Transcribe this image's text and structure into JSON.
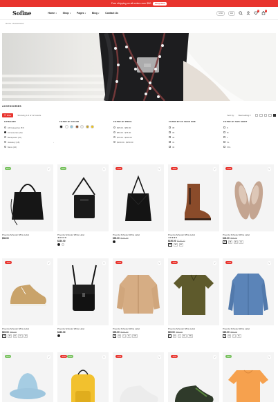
{
  "topbar": {
    "text": "Free shipping on all orders over $50",
    "cta": "Shop Now"
  },
  "header": {
    "logo": "Sofine",
    "nav": [
      "Home",
      "Shop",
      "Pages",
      "Blog",
      "Contact Us"
    ],
    "currency": "USD",
    "language": "EN",
    "wishlist_count": "0",
    "cart_count": "0"
  },
  "breadcrumb": "Home / Accessories",
  "page_title": "ACCESSORIES",
  "toolbar": {
    "filter_label": "Filter",
    "showing": "Showing 1-9 of 12 results",
    "sort_label": "Sort by:",
    "sort_value": "Best selling"
  },
  "filters": {
    "category": {
      "title": "CATEGORY",
      "items": [
        {
          "label": "All Categories (57)",
          "selected": false
        },
        {
          "label": "Accessories (22)",
          "selected": true
        },
        {
          "label": "Backpacks (10)",
          "selected": false
        },
        {
          "label": "Jewelery (18)",
          "selected": false
        },
        {
          "label": "Mens (10)",
          "selected": false
        }
      ]
    },
    "color": {
      "title": "FILTER BY COLOR",
      "swatches": [
        "#111111",
        "#ffffff",
        "#8ec9df",
        "#8b4a22",
        "#f2f2f2",
        "#c9a227",
        "#f1c40f"
      ]
    },
    "price": {
      "title": "FILTER BY PRICE",
      "items": [
        "$25.00 - $50.00",
        "$50.00 - $75.00",
        "$75.00 - $100.00",
        "$100.00 - $150.00"
      ]
    },
    "shoe_size": {
      "title": "FILTER BY EU SHOE SIZE",
      "items": [
        "38",
        "39",
        "40",
        "41",
        "42"
      ]
    },
    "shirt_size": {
      "title": "FILTER BY SIZE SHIRT",
      "items": [
        "S",
        "M",
        "L",
        "XL",
        "XXL"
      ]
    }
  },
  "products": [
    {
      "name": "Proenza Schouler White Label",
      "tag": "New",
      "tag2": "",
      "stars": "",
      "price": "$56.00",
      "old_price": "",
      "options": [],
      "colors": []
    },
    {
      "name": "Proenza Schouler White Label",
      "tag": "New",
      "tag2": "",
      "stars": "★★★★★",
      "price": "$230.00",
      "old_price": "",
      "options": [],
      "colors": [
        "#111111",
        "#ffffff"
      ]
    },
    {
      "name": "Proenza Schouler White Label",
      "tag": "-12%",
      "tag2": "",
      "stars": "",
      "price": "$95.00",
      "old_price": "$110.00",
      "options": [],
      "colors": [
        "#111111"
      ]
    },
    {
      "name": "Proenza Schouler White Label",
      "tag": "-20%",
      "tag2": "",
      "stars": "★★★★★",
      "price": "$150.00",
      "old_price": "$190.00",
      "options": [
        "38",
        "39",
        "40"
      ],
      "colors": []
    },
    {
      "name": "Proenza Schouler White Label",
      "tag": "-12%",
      "tag2": "",
      "stars": "",
      "price": "$45.00",
      "old_price": "$55.00",
      "options": [
        "38",
        "39",
        "40",
        "41"
      ],
      "colors": []
    },
    {
      "name": "Proenza Schouler White Label",
      "tag": "-15%",
      "tag2": "",
      "stars": "",
      "price": "$69.00",
      "old_price": "$80.00",
      "options": [
        "38",
        "39",
        "40",
        "41",
        "42"
      ],
      "colors": []
    },
    {
      "name": "Proenza Schouler White Label",
      "tag": "",
      "tag2": "",
      "stars": "",
      "price": "$230.00",
      "old_price": "",
      "options": [],
      "colors": [
        "#111111"
      ]
    },
    {
      "name": "Proenza Schouler White Label",
      "tag": "-12%",
      "tag2": "",
      "stars": "",
      "price": "$95.00",
      "old_price": "$110.00",
      "options": [
        "S",
        "M",
        "L",
        "XL",
        "XXL"
      ],
      "colors": []
    },
    {
      "name": "Proenza Schouler White Label",
      "tag": "-12%",
      "tag2": "",
      "stars": "",
      "price": "$69.00",
      "old_price": "$80.00",
      "options": [
        "S",
        "M",
        "L",
        "XL",
        "XXL"
      ],
      "colors": []
    },
    {
      "name": "Proenza Schouler White Label",
      "tag": "-12%",
      "tag2": "",
      "stars": "",
      "price": "$69.00",
      "old_price": "$80.00",
      "options": [
        "S",
        "M",
        "L",
        "XL"
      ],
      "colors": []
    },
    {
      "name": "",
      "tag": "New",
      "tag2": "",
      "stars": "",
      "price": "",
      "old_price": "",
      "options": [],
      "colors": []
    },
    {
      "name": "",
      "tag": "-13%",
      "tag2": "New",
      "stars": "",
      "price": "",
      "old_price": "",
      "options": [],
      "colors": []
    },
    {
      "name": "",
      "tag": "-12%",
      "tag2": "",
      "stars": "",
      "price": "",
      "old_price": "",
      "options": [],
      "colors": []
    },
    {
      "name": "",
      "tag": "-12%",
      "tag2": "",
      "stars": "",
      "price": "",
      "old_price": "",
      "options": [],
      "colors": []
    },
    {
      "name": "",
      "tag": "New",
      "tag2": "",
      "stars": "",
      "price": "",
      "old_price": "",
      "options": [],
      "colors": []
    }
  ]
}
